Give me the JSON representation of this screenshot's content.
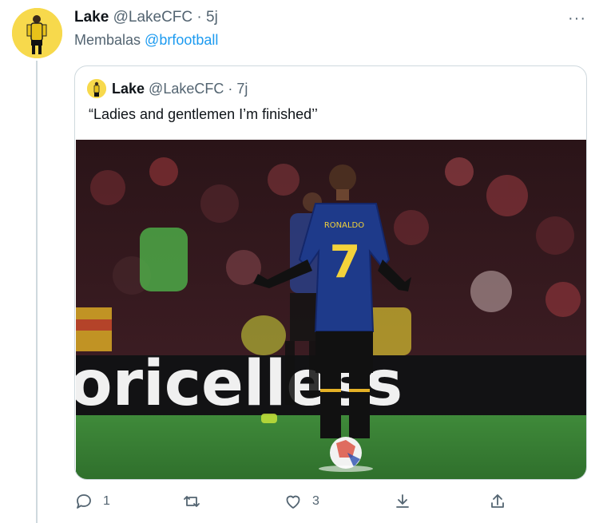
{
  "tweet": {
    "author_name": "Lake",
    "author_handle": "@LakeCFC",
    "separator": "·",
    "time": "5j",
    "reply_prefix": "Membalas",
    "reply_to": "@brfootball",
    "more_label": "···"
  },
  "quote": {
    "author_name": "Lake",
    "author_handle": "@LakeCFC",
    "separator": "·",
    "time": "7j",
    "text": "“Ladies and gentlemen I’m finished’’",
    "photo": {
      "jersey_name": "RONALDO",
      "jersey_number": "7",
      "ad_board_text": "oricelless"
    }
  },
  "actions": {
    "reply_count": "1",
    "retweet_count": "",
    "like_count": "3"
  },
  "colors": {
    "accent": "#1d9bf0",
    "muted": "#536471",
    "border": "#cfd9de",
    "avatar_bg": "#f7d94c"
  }
}
